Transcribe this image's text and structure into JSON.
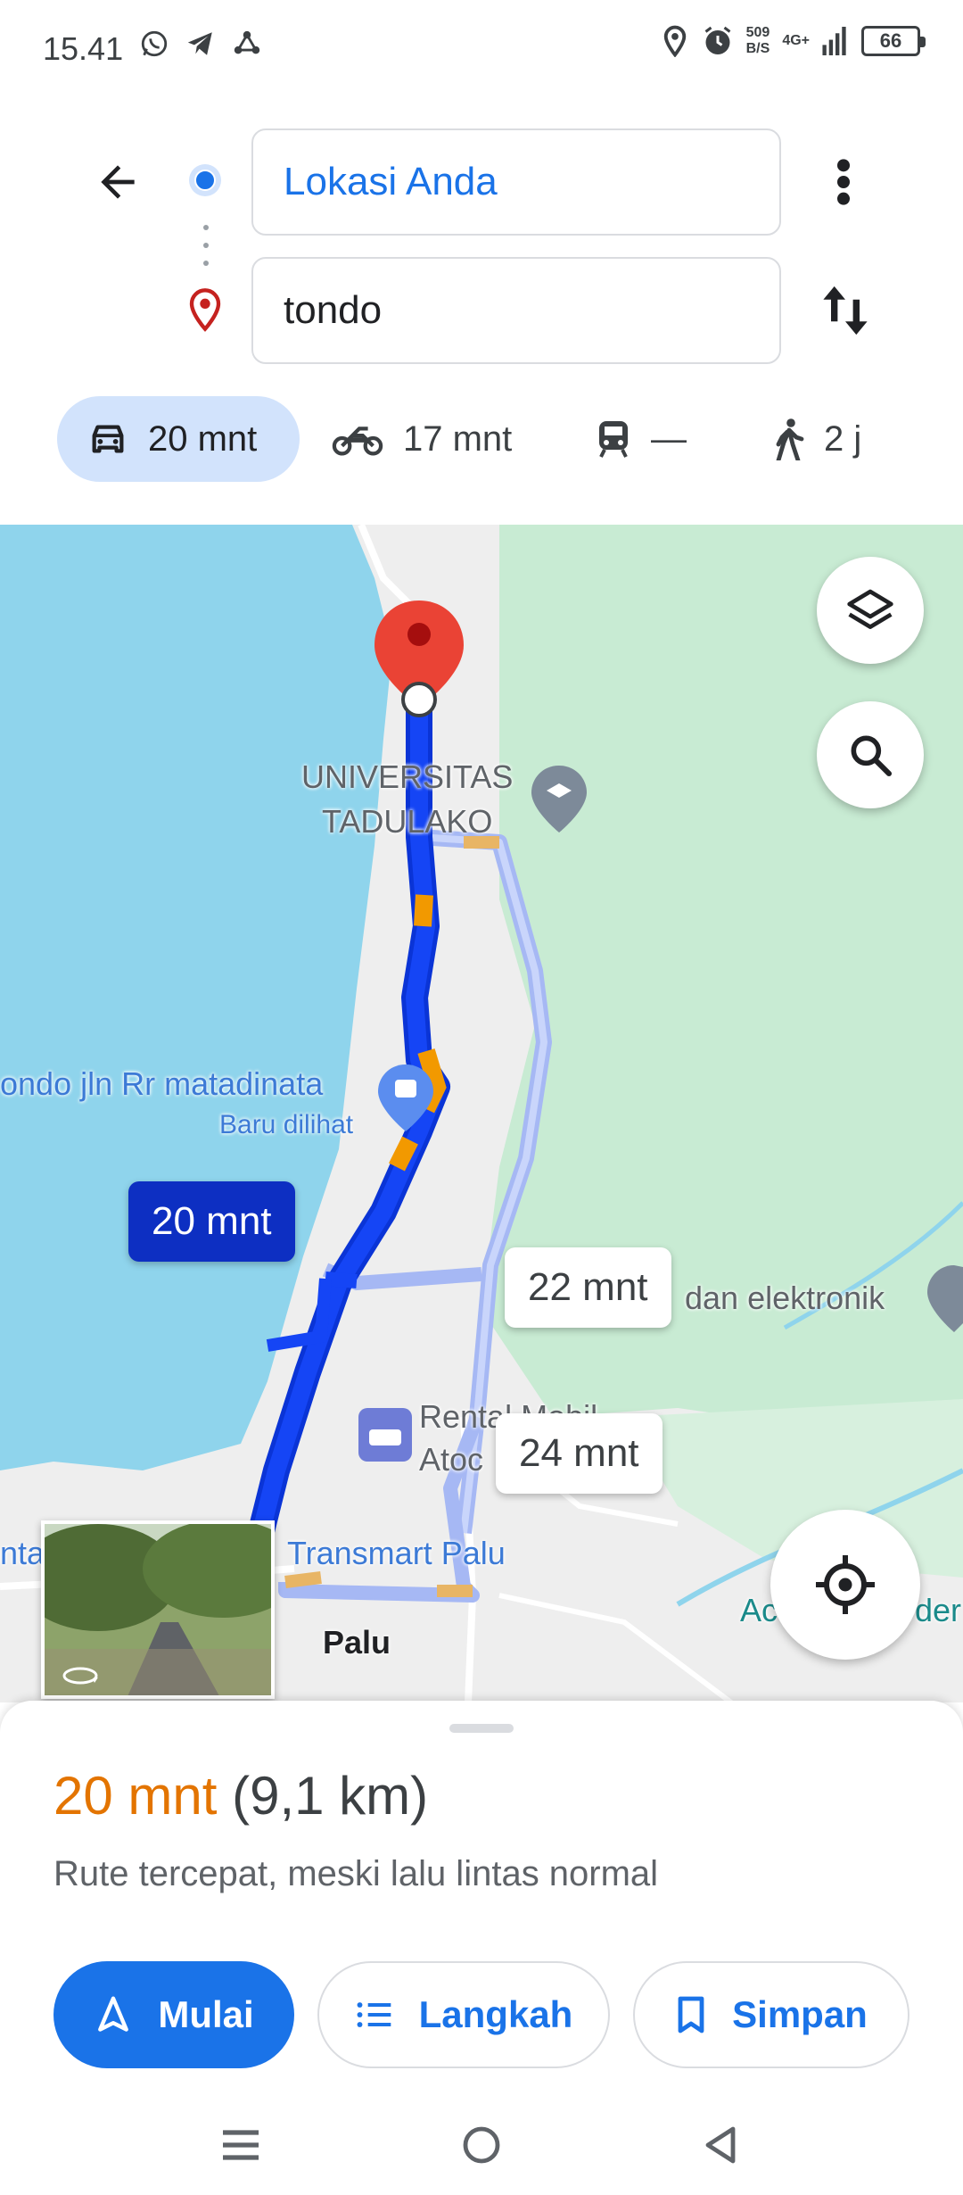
{
  "status_bar": {
    "time": "15.41",
    "net_speed_value": "509",
    "net_speed_unit": "B/S",
    "net_type": "4G+",
    "battery": "66"
  },
  "directions": {
    "origin": "Lokasi Anda",
    "destination": "tondo"
  },
  "modes": [
    {
      "name": "car",
      "label": "20 mnt",
      "icon": "car-icon",
      "selected": true
    },
    {
      "name": "motorcycle",
      "label": "17 mnt",
      "icon": "motorcycle-icon",
      "selected": false
    },
    {
      "name": "transit",
      "label": "—",
      "icon": "train-icon",
      "selected": false
    },
    {
      "name": "walk",
      "label": "2 j",
      "icon": "walk-icon",
      "selected": false
    }
  ],
  "map": {
    "labels": {
      "univ_line1": "UNIVERSITAS",
      "univ_line2": "TADULAKO",
      "place_tondo": "ondo jln Rr matadinata",
      "place_tondo_sub": "Baru dilihat",
      "elektronik": "dan elektronik",
      "rental_line1": "Rental Mobil",
      "rental_line2": "Atoc",
      "transmart": "Transmart Palu",
      "palu": "Palu",
      "left_partial": "nta",
      "right_partial_a": "Ac",
      "right_partial_b": "der"
    },
    "bubbles": {
      "primary": "20 mnt",
      "alt1": "22 mnt",
      "alt2": "24 mnt"
    },
    "colors": {
      "water": "#8fd4ec",
      "land": "#eeeeee",
      "park": "#c8ebd3",
      "route_primary": "#1545f5",
      "route_traffic": "#f29900",
      "route_alt": "#a6b8f4",
      "pin": "#ea4335"
    }
  },
  "sheet": {
    "time": "20 mnt",
    "distance": "(9,1 km)",
    "description": "Rute tercepat, meski lalu lintas normal",
    "start_label": "Mulai",
    "steps_label": "Langkah",
    "save_label": "Simpan"
  }
}
